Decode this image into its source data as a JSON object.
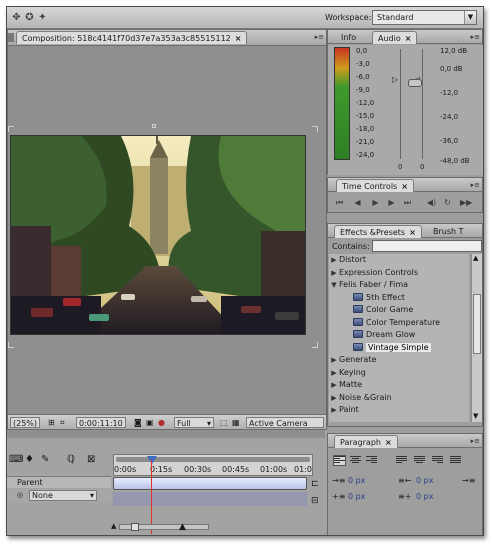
{
  "workspace": {
    "label": "Workspace:",
    "value": "Standard"
  },
  "composition": {
    "tab_label": "Composition: 518c4141f70d37e7a353a3c85515112",
    "zoom": "(25%)",
    "timecode": "0:00:11:10",
    "resolution": "Full",
    "camera": "Active Camera"
  },
  "info_audio": {
    "tabs": [
      "Info",
      "Audio"
    ],
    "meter_db": [
      "0,0",
      "-3,0",
      "-6,0",
      "-9,0",
      "-12,0",
      "-15,0",
      "-18,0",
      "-21,0",
      "-24,0"
    ],
    "slider_values": [
      "0",
      "0"
    ],
    "right_db": [
      "12,0 dB",
      "0,0 dB",
      "-12,0",
      "-24,0",
      "-36,0",
      "-48,0 dB"
    ]
  },
  "time_controls": {
    "title": "Time Controls"
  },
  "effects": {
    "tabs": [
      "Effects &Presets",
      "Brush T"
    ],
    "contains_label": "Contains:",
    "contains_value": "",
    "items": [
      {
        "label": "Distort",
        "kind": "category",
        "expanded": false
      },
      {
        "label": "Expression Controls",
        "kind": "category",
        "expanded": false
      },
      {
        "label": "Felis Faber / Fima",
        "kind": "category",
        "expanded": true
      },
      {
        "label": "5th Effect",
        "kind": "effect"
      },
      {
        "label": "Color Game",
        "kind": "effect"
      },
      {
        "label": "Color Temperature",
        "kind": "effect"
      },
      {
        "label": "Dream Glow",
        "kind": "effect"
      },
      {
        "label": "Vintage Simple",
        "kind": "effect",
        "selected": true
      },
      {
        "label": "Generate",
        "kind": "category",
        "expanded": false
      },
      {
        "label": "Keying",
        "kind": "category",
        "expanded": false
      },
      {
        "label": "Matte",
        "kind": "category",
        "expanded": false
      },
      {
        "label": "Noise &Grain",
        "kind": "category",
        "expanded": false
      },
      {
        "label": "Paint",
        "kind": "category",
        "expanded": false
      }
    ]
  },
  "timeline": {
    "parent_label": "Parent",
    "parent_value": "None",
    "ruler": [
      "0:00s",
      "0:15s",
      "00:30s",
      "00:45s",
      "01:00s",
      "01:0"
    ]
  },
  "paragraph": {
    "title": "Paragraph",
    "fields": [
      "0 px",
      "0 px",
      "0 px",
      "0 px",
      "0 px"
    ]
  },
  "colors": {
    "panel": "#9e9e9e",
    "meter_green": "#3f9a2f",
    "meter_red": "#b8321e",
    "playhead": "#e0312a"
  }
}
